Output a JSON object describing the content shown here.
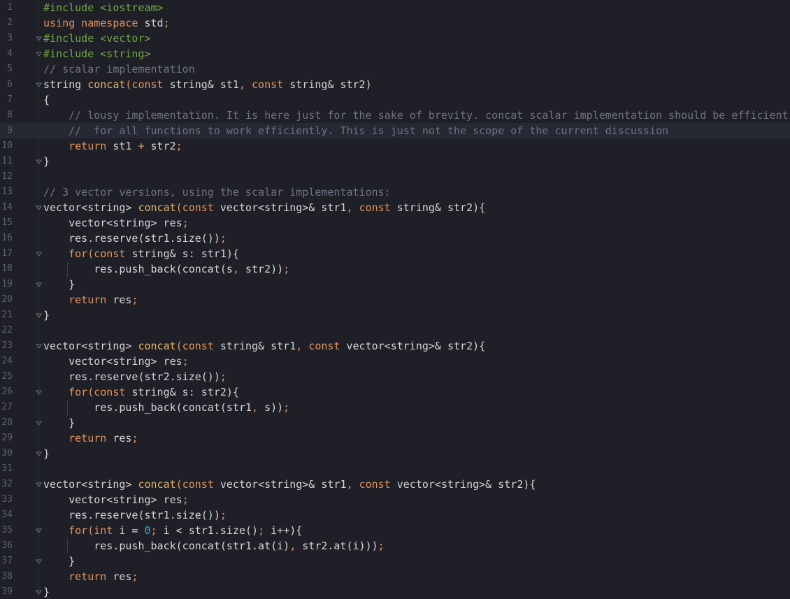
{
  "editor": {
    "current_line": 9,
    "lines": [
      {
        "n": "1",
        "tokens": [
          {
            "t": "#include <iostream>",
            "k": "pre"
          }
        ]
      },
      {
        "n": "2",
        "tokens": [
          {
            "t": "using namespace ",
            "k": "kw"
          },
          {
            "t": "std",
            "k": "text"
          },
          {
            "t": ";",
            "k": "op"
          }
        ]
      },
      {
        "n": "3",
        "fold": true,
        "tokens": [
          {
            "t": "#include <vector>",
            "k": "pre"
          }
        ]
      },
      {
        "n": "4",
        "fold": true,
        "tokens": [
          {
            "t": "#include <string>",
            "k": "pre"
          }
        ]
      },
      {
        "n": "5",
        "tokens": [
          {
            "t": "// scalar implementation",
            "k": "cmt"
          }
        ]
      },
      {
        "n": "6",
        "fold": true,
        "tokens": [
          {
            "t": "string ",
            "k": "text"
          },
          {
            "t": "concat",
            "k": "fn"
          },
          {
            "t": "(",
            "k": "op"
          },
          {
            "t": "const ",
            "k": "kw"
          },
          {
            "t": "string& st1",
            "k": "text"
          },
          {
            "t": ", ",
            "k": "op"
          },
          {
            "t": "const ",
            "k": "kw"
          },
          {
            "t": "string& str2)",
            "k": "text"
          }
        ]
      },
      {
        "n": "7",
        "tokens": [
          {
            "t": "{",
            "k": "text"
          }
        ]
      },
      {
        "n": "8",
        "tokens": [
          {
            "t": "    // lousy implementation. It is here just for the sake of brevity. concat scalar implementation should be efficient",
            "k": "cmt"
          }
        ]
      },
      {
        "n": "9",
        "tokens": [
          {
            "t": "    //  for all functions to work efficiently. This is just not the scope of the current discussion",
            "k": "cmt"
          }
        ]
      },
      {
        "n": "10",
        "tokens": [
          {
            "t": "    ",
            "k": "text"
          },
          {
            "t": "return ",
            "k": "kw"
          },
          {
            "t": "st1 ",
            "k": "text"
          },
          {
            "t": "+ ",
            "k": "op"
          },
          {
            "t": "str2",
            "k": "text"
          },
          {
            "t": ";",
            "k": "op"
          }
        ]
      },
      {
        "n": "11",
        "fold": true,
        "tokens": [
          {
            "t": "}",
            "k": "text"
          }
        ]
      },
      {
        "n": "12",
        "tokens": []
      },
      {
        "n": "13",
        "tokens": [
          {
            "t": "// 3 vector versions, using the scalar implementations:",
            "k": "cmt"
          }
        ]
      },
      {
        "n": "14",
        "fold": true,
        "tokens": [
          {
            "t": "vector<string> ",
            "k": "text"
          },
          {
            "t": "concat",
            "k": "fn"
          },
          {
            "t": "(",
            "k": "op"
          },
          {
            "t": "const ",
            "k": "kw"
          },
          {
            "t": "vector<string>& str1",
            "k": "text"
          },
          {
            "t": ", ",
            "k": "op"
          },
          {
            "t": "const ",
            "k": "kw"
          },
          {
            "t": "string& str2){",
            "k": "text"
          }
        ]
      },
      {
        "n": "15",
        "tokens": [
          {
            "t": "    vector<string> res",
            "k": "text"
          },
          {
            "t": ";",
            "k": "op"
          }
        ]
      },
      {
        "n": "16",
        "tokens": [
          {
            "t": "    res.reserve(str1.size())",
            "k": "text"
          },
          {
            "t": ";",
            "k": "op"
          }
        ]
      },
      {
        "n": "17",
        "fold": true,
        "tokens": [
          {
            "t": "    ",
            "k": "text"
          },
          {
            "t": "for",
            "k": "kw"
          },
          {
            "t": "(",
            "k": "op"
          },
          {
            "t": "const ",
            "k": "kw"
          },
          {
            "t": "string& s: str1){",
            "k": "text"
          }
        ]
      },
      {
        "n": "18",
        "guide": true,
        "tokens": [
          {
            "t": "        res.push_back(concat(s",
            "k": "text"
          },
          {
            "t": ", ",
            "k": "op"
          },
          {
            "t": "str2))",
            "k": "text"
          },
          {
            "t": ";",
            "k": "op"
          }
        ]
      },
      {
        "n": "19",
        "fold": true,
        "tokens": [
          {
            "t": "    }",
            "k": "text"
          }
        ]
      },
      {
        "n": "20",
        "tokens": [
          {
            "t": "    ",
            "k": "text"
          },
          {
            "t": "return ",
            "k": "kw"
          },
          {
            "t": "res",
            "k": "text"
          },
          {
            "t": ";",
            "k": "op"
          }
        ]
      },
      {
        "n": "21",
        "fold": true,
        "tokens": [
          {
            "t": "}",
            "k": "text"
          }
        ]
      },
      {
        "n": "22",
        "tokens": []
      },
      {
        "n": "23",
        "fold": true,
        "tokens": [
          {
            "t": "vector<string> ",
            "k": "text"
          },
          {
            "t": "concat",
            "k": "fn"
          },
          {
            "t": "(",
            "k": "op"
          },
          {
            "t": "const ",
            "k": "kw"
          },
          {
            "t": "string& str1",
            "k": "text"
          },
          {
            "t": ", ",
            "k": "op"
          },
          {
            "t": "const ",
            "k": "kw"
          },
          {
            "t": "vector<string>& str2){",
            "k": "text"
          }
        ]
      },
      {
        "n": "24",
        "tokens": [
          {
            "t": "    vector<string> res",
            "k": "text"
          },
          {
            "t": ";",
            "k": "op"
          }
        ]
      },
      {
        "n": "25",
        "tokens": [
          {
            "t": "    res.reserve(str2.size())",
            "k": "text"
          },
          {
            "t": ";",
            "k": "op"
          }
        ]
      },
      {
        "n": "26",
        "fold": true,
        "tokens": [
          {
            "t": "    ",
            "k": "text"
          },
          {
            "t": "for",
            "k": "kw"
          },
          {
            "t": "(",
            "k": "op"
          },
          {
            "t": "const ",
            "k": "kw"
          },
          {
            "t": "string& s: str2){",
            "k": "text"
          }
        ]
      },
      {
        "n": "27",
        "guide": true,
        "tokens": [
          {
            "t": "        res.push_back(concat(str1",
            "k": "text"
          },
          {
            "t": ", ",
            "k": "op"
          },
          {
            "t": "s))",
            "k": "text"
          },
          {
            "t": ";",
            "k": "op"
          }
        ]
      },
      {
        "n": "28",
        "fold": true,
        "tokens": [
          {
            "t": "    }",
            "k": "text"
          }
        ]
      },
      {
        "n": "29",
        "tokens": [
          {
            "t": "    ",
            "k": "text"
          },
          {
            "t": "return ",
            "k": "kw"
          },
          {
            "t": "res",
            "k": "text"
          },
          {
            "t": ";",
            "k": "op"
          }
        ]
      },
      {
        "n": "30",
        "fold": true,
        "tokens": [
          {
            "t": "}",
            "k": "text"
          }
        ]
      },
      {
        "n": "31",
        "tokens": []
      },
      {
        "n": "32",
        "fold": true,
        "tokens": [
          {
            "t": "vector<string> ",
            "k": "text"
          },
          {
            "t": "concat",
            "k": "fn"
          },
          {
            "t": "(",
            "k": "op"
          },
          {
            "t": "const ",
            "k": "kw"
          },
          {
            "t": "vector<string>& str1",
            "k": "text"
          },
          {
            "t": ", ",
            "k": "op"
          },
          {
            "t": "const ",
            "k": "kw"
          },
          {
            "t": "vector<string>& str2){",
            "k": "text"
          }
        ]
      },
      {
        "n": "33",
        "tokens": [
          {
            "t": "    vector<string> res",
            "k": "text"
          },
          {
            "t": ";",
            "k": "op"
          }
        ]
      },
      {
        "n": "34",
        "tokens": [
          {
            "t": "    res.reserve(str1.size())",
            "k": "text"
          },
          {
            "t": ";",
            "k": "op"
          }
        ]
      },
      {
        "n": "35",
        "fold": true,
        "tokens": [
          {
            "t": "    ",
            "k": "text"
          },
          {
            "t": "for",
            "k": "kw"
          },
          {
            "t": "(",
            "k": "op"
          },
          {
            "t": "int ",
            "k": "kw"
          },
          {
            "t": "i = ",
            "k": "text"
          },
          {
            "t": "0",
            "k": "num"
          },
          {
            "t": "; ",
            "k": "op"
          },
          {
            "t": "i < str1.size()",
            "k": "text"
          },
          {
            "t": "; ",
            "k": "op"
          },
          {
            "t": "i++){",
            "k": "text"
          }
        ]
      },
      {
        "n": "36",
        "guide": true,
        "tokens": [
          {
            "t": "        res.push_back(concat(str1.at(i)",
            "k": "text"
          },
          {
            "t": ", ",
            "k": "op"
          },
          {
            "t": "str2.at(i)))",
            "k": "text"
          },
          {
            "t": ";",
            "k": "op"
          }
        ]
      },
      {
        "n": "37",
        "fold": true,
        "tokens": [
          {
            "t": "    }",
            "k": "text"
          }
        ]
      },
      {
        "n": "38",
        "tokens": [
          {
            "t": "    ",
            "k": "text"
          },
          {
            "t": "return ",
            "k": "kw"
          },
          {
            "t": "res",
            "k": "text"
          },
          {
            "t": ";",
            "k": "op"
          }
        ]
      },
      {
        "n": "39",
        "fold": true,
        "tokens": [
          {
            "t": "}",
            "k": "text"
          }
        ]
      }
    ]
  },
  "colors": {
    "background": "#1e1f27",
    "current_line": "#262833",
    "preprocessor": "#72a846",
    "keyword": "#e3935d",
    "function": "#e3b46b",
    "comment": "#707383",
    "number": "#3aa7e0",
    "text": "#d6d6d6"
  },
  "icons": {
    "fold_marker": "fold-marker-icon"
  }
}
